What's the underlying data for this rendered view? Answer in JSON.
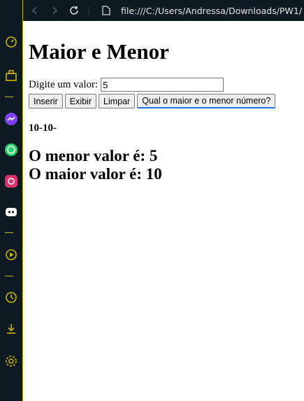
{
  "browser": {
    "url": "file:///C:/Users/Andressa/Downloads/PW1/"
  },
  "page": {
    "title": "Maior e Menor",
    "input_label": "Digite um valor:",
    "input_value": "5",
    "buttons": {
      "insert": "Inserir",
      "show": "Exibir",
      "clear": "Limpar",
      "compute": "Qual o maior e o menor número?"
    },
    "listing": "10-10-",
    "min_text": "O menor valor é: 5",
    "max_text": "O maior valor é: 10"
  },
  "sidebar": {
    "icons": [
      "speed-dial-icon",
      "briefcase-icon",
      "messenger-icon",
      "whatsapp-icon",
      "instagram-icon",
      "discord-icon",
      "player-icon",
      "history-icon",
      "downloads-icon",
      "settings-icon"
    ]
  },
  "colors": {
    "sidebar_bg": "#0e1a22",
    "accent": "#c9b400"
  }
}
